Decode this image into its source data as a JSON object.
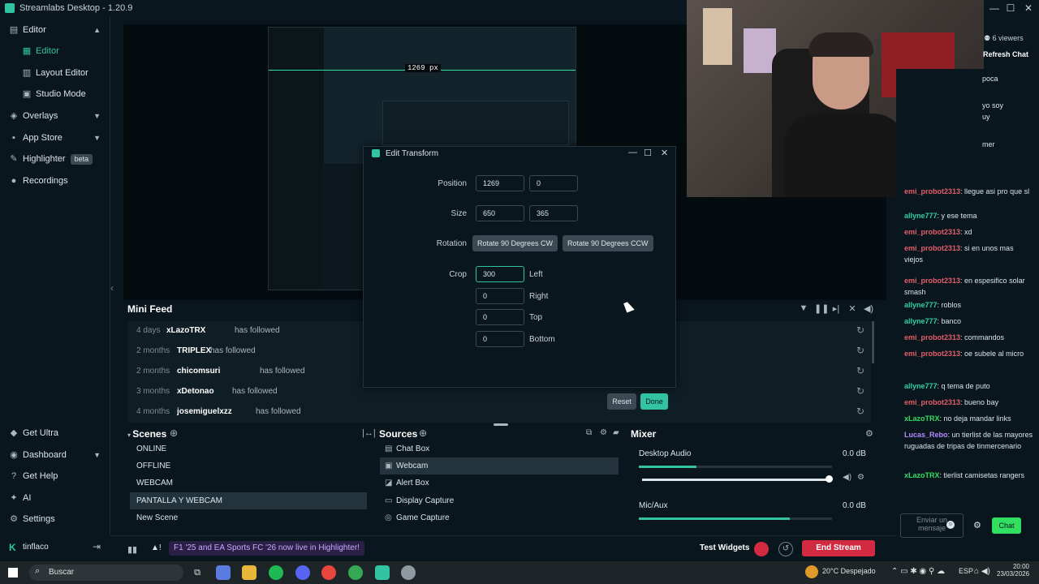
{
  "window": {
    "title": "Streamlabs Desktop - 1.20.9",
    "viewers": "6 viewers",
    "refresh_chat": "Refresh Chat"
  },
  "nav": {
    "items": [
      {
        "label": "Editor",
        "icon": "editor-icon"
      },
      {
        "label": "Editor",
        "icon": "editor-icon"
      },
      {
        "label": "Layout Editor",
        "icon": "layout-icon"
      },
      {
        "label": "Studio Mode",
        "icon": "studio-icon"
      },
      {
        "label": "Overlays",
        "icon": "overlays-icon"
      },
      {
        "label": "App Store",
        "icon": "store-icon"
      },
      {
        "label": "Highlighter",
        "badge": "beta",
        "icon": "highlighter-icon"
      },
      {
        "label": "Recordings",
        "icon": "recordings-icon"
      }
    ],
    "bottom": [
      {
        "label": "Get Ultra"
      },
      {
        "label": "Dashboard"
      },
      {
        "label": "Get Help"
      },
      {
        "label": "AI"
      },
      {
        "label": "Settings"
      },
      {
        "label": "tinflaco"
      }
    ]
  },
  "preview": {
    "size_readout": "1269 px"
  },
  "minifeed": {
    "title": "Mini Feed",
    "rows": [
      {
        "time": "4 days",
        "name": "xLazoTRX",
        "action": "has followed"
      },
      {
        "time": "2 months",
        "name": "TRIPLEX",
        "action": "has followed"
      },
      {
        "time": "2 months",
        "name": "chicomsuri",
        "action": "has followed"
      },
      {
        "time": "3 months",
        "name": "xDetonao",
        "action": "has followed"
      },
      {
        "time": "4 months",
        "name": "josemiguelxzz",
        "action": "has followed"
      }
    ]
  },
  "scenes": {
    "title": "Scenes",
    "items": [
      "ONLINE",
      "OFFLINE",
      "WEBCAM",
      "PANTALLA Y WEBCAM",
      "New Scene"
    ]
  },
  "sources": {
    "title": "Sources",
    "items": [
      "Chat Box",
      "Webcam",
      "Alert Box",
      "Display Capture",
      "Game Capture"
    ]
  },
  "mixer": {
    "title": "Mixer",
    "channels": [
      {
        "name": "Desktop Audio",
        "db": "0.0 dB",
        "level": 0.3
      },
      {
        "name": "Mic/Aux",
        "db": "0.0 dB",
        "level": 0.78
      }
    ]
  },
  "status": {
    "promo": "F1 '25 and EA Sports FC '26 now live in Highlighter!",
    "test_widgets": "Test Widgets",
    "end_stream": "End Stream"
  },
  "dialog": {
    "title": "Edit Transform",
    "position_label": "Position",
    "position_x": "1269",
    "position_y": "0",
    "size_label": "Size",
    "size_w": "650",
    "size_h": "365",
    "rotation_label": "Rotation",
    "rotate_cw": "Rotate 90 Degrees CW",
    "rotate_ccw": "Rotate 90 Degrees CCW",
    "crop_label": "Crop",
    "crop_left": "300",
    "crop_right": "0",
    "crop_top": "0",
    "crop_bottom": "0",
    "left_label": "Left",
    "right_label": "Right",
    "top_label": "Top",
    "bottom_label": "Bottom",
    "reset": "Reset",
    "done": "Done"
  },
  "chat": {
    "messages": [
      {
        "user": "",
        "text": "poca",
        "color": "#dbe5ea"
      },
      {
        "user": "",
        "text": "yo soy",
        "color": "#dbe5ea"
      },
      {
        "user": "",
        "text": "uy",
        "color": "#dbe5ea"
      },
      {
        "user": "",
        "text": "mer",
        "color": "#dbe5ea"
      },
      {
        "user": "emi_probot2313",
        "text": ": llegue asi pro que sl",
        "color": "#e35d6a"
      },
      {
        "user": "allyne777",
        "text": ": y ese tema",
        "color": "#2fd1a5"
      },
      {
        "user": "emi_probot2313",
        "text": ": xd",
        "color": "#e35d6a"
      },
      {
        "user": "emi_probot2313",
        "text": ": si en unos mas viejos",
        "color": "#e35d6a"
      },
      {
        "user": "emi_probot2313",
        "text": ": en espesifico solar smash",
        "color": "#e35d6a"
      },
      {
        "user": "allyne777",
        "text": ": roblos",
        "color": "#2fd1a5"
      },
      {
        "user": "allyne777",
        "text": ": banco",
        "color": "#2fd1a5"
      },
      {
        "user": "emi_probot2313",
        "text": ": commandos",
        "color": "#e35d6a"
      },
      {
        "user": "emi_probot2313",
        "text": ": oe subele al micro",
        "color": "#e35d6a"
      },
      {
        "user": "allyne777",
        "text": ": q tema de puto",
        "color": "#2fd1a5"
      },
      {
        "user": "emi_probot2313",
        "text": ": bueno bay",
        "color": "#e35d6a"
      },
      {
        "user": "xLazoTRX",
        "text": ": no deja mandar links",
        "color": "#31e060"
      },
      {
        "user": "Lucas_Rebo",
        "text": ": un tierlist de las mayores ruguadas de tripas de tinmercenario",
        "color": "#b78aff"
      },
      {
        "user": "xLazoTRX",
        "text": ": tierlist camisetas rangers",
        "color": "#31e060"
      }
    ],
    "input_placeholder": "Enviar un mensaje",
    "send": "Chat"
  },
  "taskbar": {
    "search": "Buscar",
    "weather": "20°C  Despejado",
    "lang": "ESP",
    "time": "20:00",
    "date": "23/03/2026"
  }
}
